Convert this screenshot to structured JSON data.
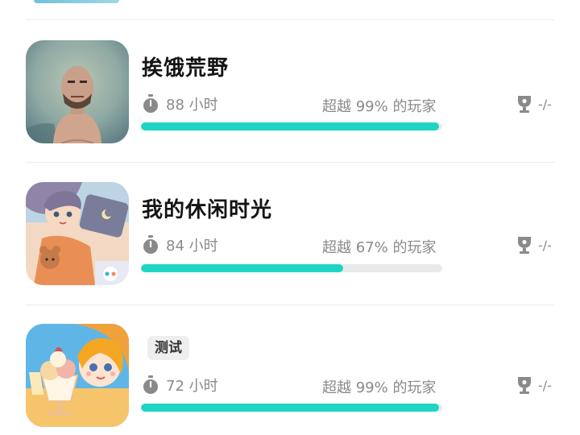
{
  "games": [
    {
      "title": "挨饿荒野",
      "tag": "",
      "hours_label": "88 小时",
      "rank_label": "超越 99% 的玩家",
      "achievement_label": "-/-",
      "progress": 0.99
    },
    {
      "title": "我的休闲时光",
      "tag": "",
      "hours_label": "84 小时",
      "rank_label": "超越 67% 的玩家",
      "achievement_label": "-/-",
      "progress": 0.67
    },
    {
      "title": "",
      "tag": "测试",
      "hours_label": "72 小时",
      "rank_label": "超越 99% 的玩家",
      "achievement_label": "-/-",
      "progress": 0.99
    }
  ],
  "icons": {
    "clock": "stopwatch-icon",
    "trophy": "trophy-icon"
  },
  "colors": {
    "accent": "#1ed4c4",
    "track": "#e9eaec",
    "muted_text": "#8a8a8a"
  }
}
